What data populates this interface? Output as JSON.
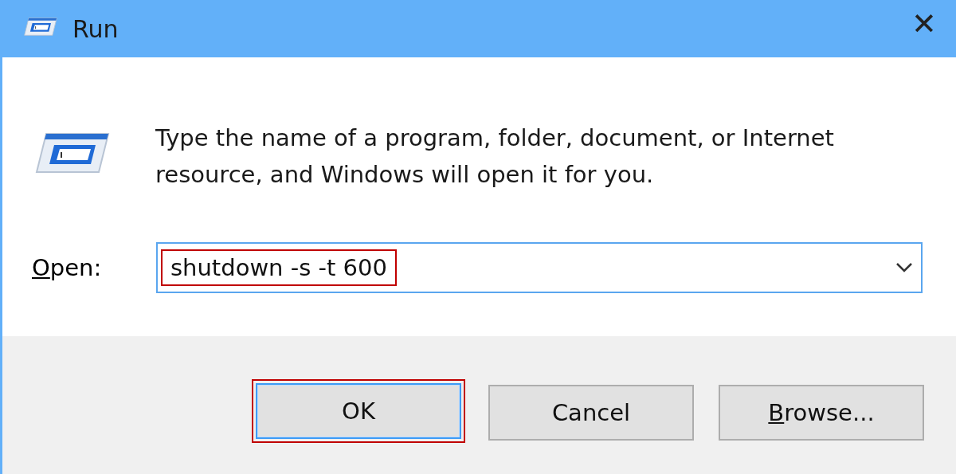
{
  "window": {
    "title": "Run",
    "close": "✕"
  },
  "message": "Type the name of a program, folder, document, or Internet resource, and Windows will open it for you.",
  "open_field": {
    "label": "Open:",
    "label_access_key_underlined": true,
    "value": "shutdown -s -t 600",
    "highlighted": true
  },
  "buttons": [
    {
      "label": "OK",
      "default": true,
      "highlighted": true,
      "access_key_underlined": false
    },
    {
      "label": "Cancel",
      "default": false,
      "highlighted": false,
      "access_key_underlined": false
    },
    {
      "label": "Browse...",
      "default": false,
      "highlighted": false,
      "access_key_underlined": true
    }
  ]
}
